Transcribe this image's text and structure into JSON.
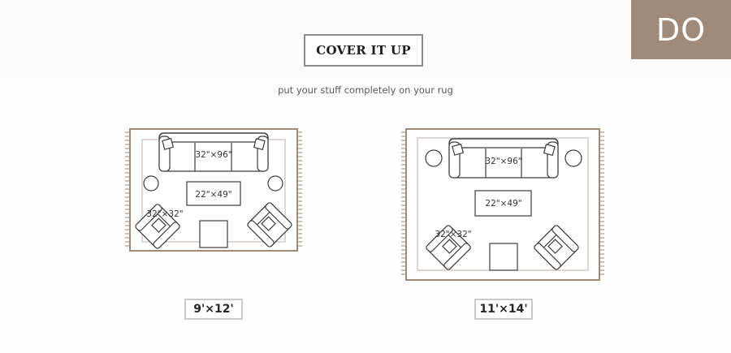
{
  "badge": {
    "label": "DO"
  },
  "heading": {
    "title": "COVER IT UP",
    "subtitle": "put your stuff completely on your rug"
  },
  "plans": [
    {
      "rug_size": "9'×12'",
      "sofa_label": "32\"×96\"",
      "table_label": "22\"×49\"",
      "chair_label": "32\"×32\""
    },
    {
      "rug_size": "11'×14'",
      "sofa_label": "32\"×96\"",
      "table_label": "22\"×49\"",
      "chair_label": "32\"×32\""
    }
  ],
  "colors": {
    "badge": "#a08b7b",
    "rug_border": "#a08b7b",
    "furniture_stroke": "#3c3c3c",
    "fringe": "#9a8474"
  }
}
